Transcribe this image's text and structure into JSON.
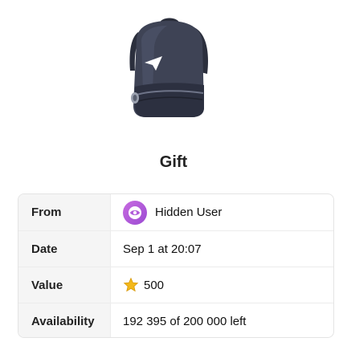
{
  "gift": {
    "title": "Gift",
    "image_icon": "backpack-icon"
  },
  "details": {
    "rows": [
      {
        "label": "From",
        "value": "Hidden User",
        "icon": "hidden-user-avatar"
      },
      {
        "label": "Date",
        "value": "Sep 1 at 20:07"
      },
      {
        "label": "Value",
        "value": "500",
        "icon": "star-icon"
      },
      {
        "label": "Availability",
        "value": "192 395 of 200 000 left"
      }
    ]
  },
  "colors": {
    "avatar": "#b05ad9",
    "star": "#f3b81a",
    "backpack": "#3a3f52"
  }
}
